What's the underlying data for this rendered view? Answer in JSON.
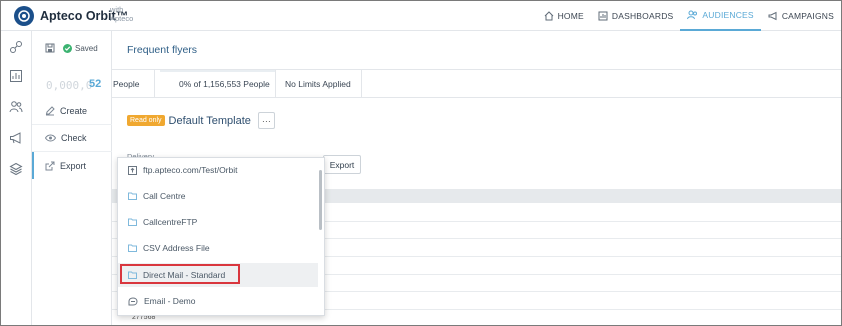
{
  "app": {
    "name": "Apteco Orbit™",
    "with_label": "with",
    "with_brand": "Apteco"
  },
  "nav": [
    {
      "label": "HOME",
      "icon": "home-icon",
      "active": false
    },
    {
      "label": "DASHBOARDS",
      "icon": "dashboard-icon",
      "active": false
    },
    {
      "label": "AUDIENCES",
      "icon": "people-icon",
      "active": true
    },
    {
      "label": "CAMPAIGNS",
      "icon": "megaphone-icon",
      "active": false
    }
  ],
  "rail": [
    "link-icon",
    "chart-icon",
    "people-icon",
    "megaphone-icon",
    "layers-icon"
  ],
  "status": {
    "saved_label": "Saved"
  },
  "count": {
    "ghost": "0,000,0",
    "value": "52"
  },
  "side_menu": [
    {
      "label": "Create",
      "icon": "edit-icon",
      "active": false
    },
    {
      "label": "Check",
      "icon": "eye-icon",
      "active": false
    },
    {
      "label": "Export",
      "icon": "export-icon",
      "active": true
    }
  ],
  "audience": {
    "title": "Frequent flyers"
  },
  "stats": {
    "people_label": "People",
    "percent_text": "0% of 1,156,553 People",
    "percent_fraction": 0.0,
    "limits_text": "No Limits Applied"
  },
  "template": {
    "badge": "Read only",
    "name": "Default Template",
    "more": "···"
  },
  "delivery": {
    "label": "Delivery",
    "export_button": "Export"
  },
  "table": {
    "partial_row_value": "277568"
  },
  "dropdown": {
    "items": [
      {
        "label": "ftp.apteco.com/Test/Orbit",
        "icon": "upload-icon"
      },
      {
        "label": "Call Centre",
        "icon": "folder-icon"
      },
      {
        "label": "CallcentreFTP",
        "icon": "folder-icon"
      },
      {
        "label": "CSV Address File",
        "icon": "folder-icon"
      },
      {
        "label": "Direct Mail - Standard",
        "icon": "folder-icon",
        "highlighted": true
      },
      {
        "label": "Email - Demo",
        "icon": "email-icon"
      }
    ]
  },
  "colors": {
    "accent": "#5aa9d6",
    "badge": "#f0a830",
    "saved": "#3cb371",
    "highlight": "#d9363e"
  }
}
